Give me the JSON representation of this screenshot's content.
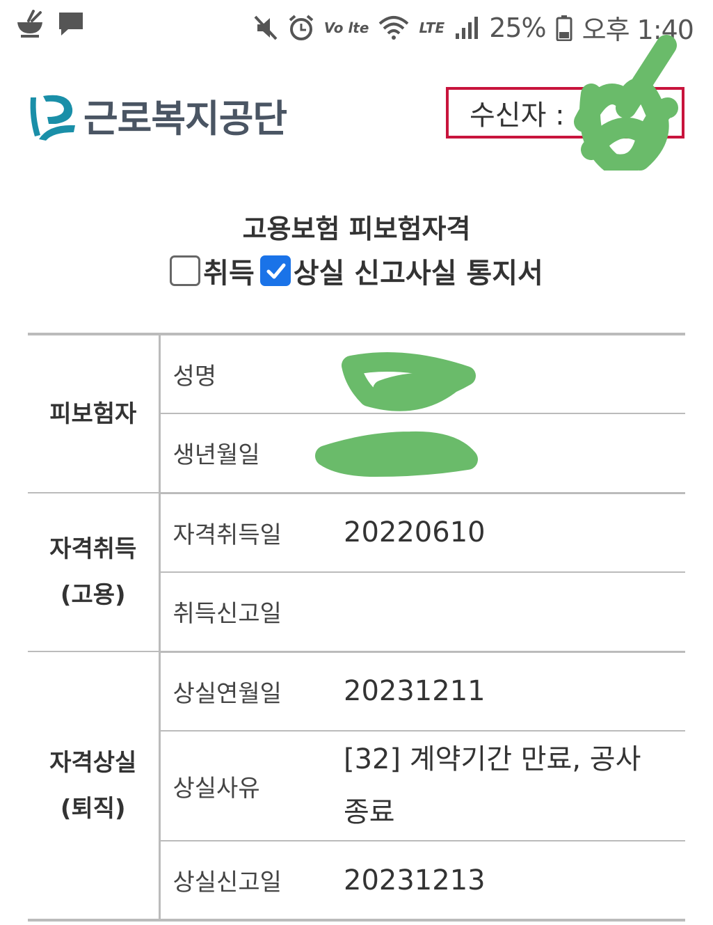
{
  "status_bar": {
    "battery": "25%",
    "time": "오후 1:40",
    "volte": "Vo lte",
    "lte": "LTE",
    "icons": [
      "bowl-icon",
      "chat-icon",
      "mute-icon",
      "alarm-icon",
      "wifi-icon",
      "signal-icon",
      "battery-icon"
    ]
  },
  "header": {
    "logo_text": "근로복지공단",
    "recipient_label": "수신자 :"
  },
  "document": {
    "title": "고용보험 피보험자격",
    "subtitle_acquire": "취득",
    "subtitle_lose": "상실 신고사실 통지서",
    "acquire_checked": false,
    "lose_checked": true
  },
  "table": {
    "insured": {
      "group": "피보험자",
      "name_label": "성명",
      "birth_label": "생년월일"
    },
    "acquire": {
      "group_line1": "자격취득",
      "group_line2": "(고용)",
      "date_label": "자격취득일",
      "date_value": "20220610",
      "report_label": "취득신고일",
      "report_value": ""
    },
    "lose": {
      "group_line1": "자격상실",
      "group_line2": "(퇴직)",
      "date_label": "상실연월일",
      "date_value": "20231211",
      "reason_label": "상실사유",
      "reason_value": "[32] 계약기간 만료, 공사 종료",
      "report_label": "상실신고일",
      "report_value": "20231213"
    }
  },
  "colors": {
    "accent_blue": "#1a73e8",
    "recipient_border": "#c8143c",
    "redaction_green": "#6abb6a",
    "logo_teal": "#1a8fa8"
  }
}
